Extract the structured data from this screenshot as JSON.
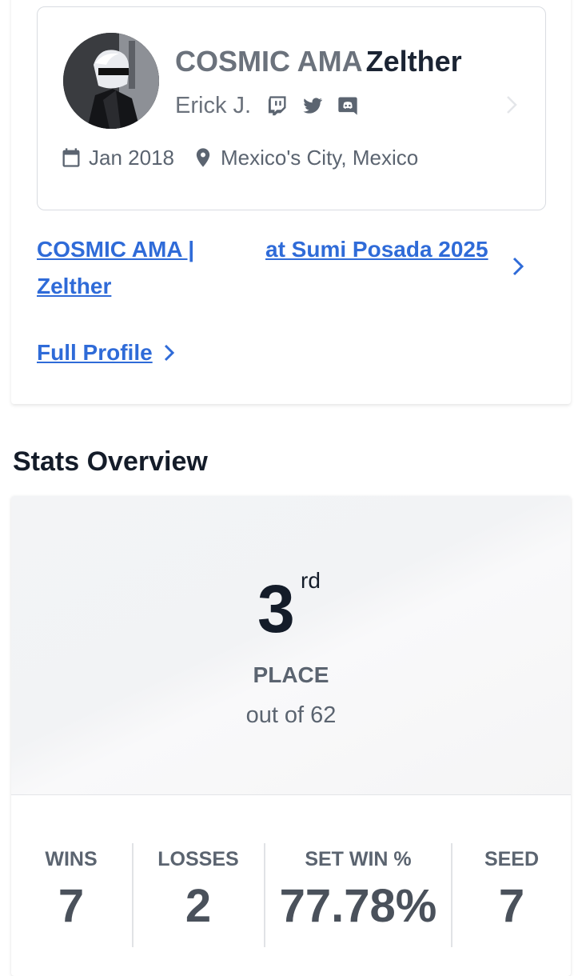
{
  "profile": {
    "prefix": "COSMIC AMA",
    "tag": "Zelther",
    "real_name": "Erick J.",
    "social_icons": [
      "twitch-icon",
      "twitter-icon",
      "discord-icon"
    ],
    "joined": "Jan 2018",
    "location": "Mexico's City, Mexico"
  },
  "event": {
    "player_line1": "COSMIC AMA |",
    "player_line2": "Zelther",
    "tournament": "at Sumi Posada 2025"
  },
  "links": {
    "full_profile": "Full Profile"
  },
  "stats": {
    "heading": "Stats Overview",
    "place_number": "3",
    "place_suffix": "rd",
    "place_label": "PLACE",
    "out_of": "out of 62",
    "wins_label": "WINS",
    "wins_value": "7",
    "losses_label": "LOSSES",
    "losses_value": "2",
    "setwin_label": "SET WIN %",
    "setwin_value": "77.78%",
    "seed_label": "SEED",
    "seed_value": "7"
  },
  "colors": {
    "link": "#2f6bd8",
    "muted": "#5b6470",
    "heading": "#141c29"
  }
}
